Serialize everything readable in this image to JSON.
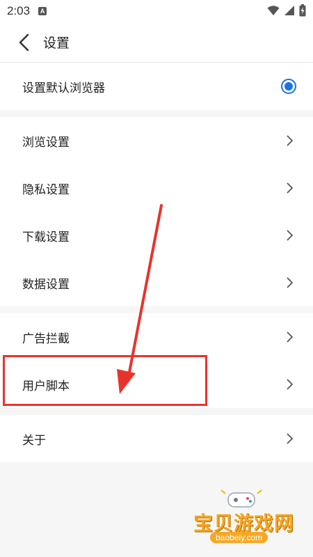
{
  "statusbar": {
    "time": "2:03",
    "notification_letter": "A",
    "icons": [
      "wifi-icon",
      "signal-icon",
      "battery-icon"
    ]
  },
  "header": {
    "title": "设置"
  },
  "default_browser": {
    "label": "设置默认浏览器",
    "selected": true
  },
  "group1": [
    {
      "label": "浏览设置"
    },
    {
      "label": "隐私设置"
    },
    {
      "label": "下载设置"
    },
    {
      "label": "数据设置"
    }
  ],
  "group2": [
    {
      "label": "广告拦截"
    },
    {
      "label": "用户脚本"
    }
  ],
  "group3": [
    {
      "label": "关于"
    }
  ],
  "watermark": {
    "title": "宝贝游戏网",
    "url": "baobeiy.com"
  },
  "colors": {
    "accent": "#1a73e8",
    "annotation": "#e8332d"
  }
}
